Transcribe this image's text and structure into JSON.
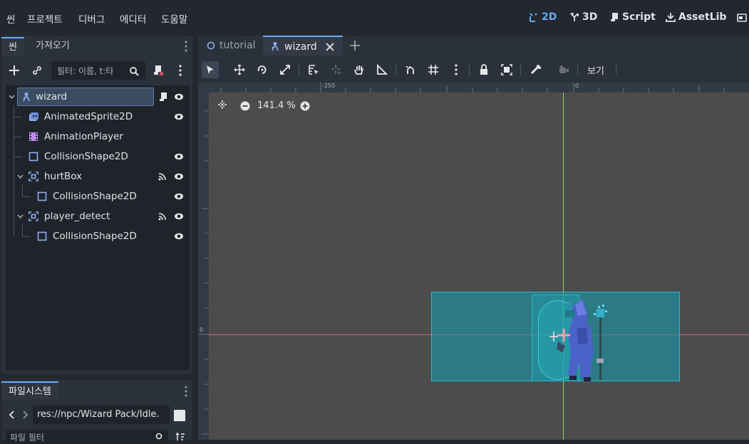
{
  "menubar": {
    "items": [
      "씬",
      "프로젝트",
      "디버그",
      "에디터",
      "도움말"
    ]
  },
  "main_screens": {
    "mode_2d": "2D",
    "mode_3d": "3D",
    "script": "Script",
    "assetlib": "AssetLib"
  },
  "scene_dock": {
    "tabs": [
      "씬",
      "가져오기"
    ],
    "filter_placeholder": "필터: 이름, t:타",
    "nodes": [
      {
        "name": "wizard",
        "selected": true,
        "has_script": true,
        "visible": true
      },
      {
        "name": "AnimatedSprite2D",
        "visible": true
      },
      {
        "name": "AnimationPlayer"
      },
      {
        "name": "CollisionShape2D",
        "visible": true
      },
      {
        "name": "hurtBox",
        "signals": true,
        "visible": true,
        "expanded": true
      },
      {
        "name": "CollisionShape2D",
        "visible": true
      },
      {
        "name": "player_detect",
        "signals": true,
        "visible": true,
        "expanded": true
      },
      {
        "name": "CollisionShape2D",
        "visible": true
      }
    ]
  },
  "filesystem_dock": {
    "tab": "파일시스템",
    "path": "res://npc/Wizard Pack/Idle.",
    "filter_placeholder": "파일 필터"
  },
  "editor": {
    "tabs": [
      "tutorial",
      "wizard"
    ],
    "active_tab": "wizard",
    "view_menu": "보기",
    "zoom": "141.4 %",
    "ruler_labels": [
      "-250",
      "0"
    ],
    "ruler_left_label": "0"
  },
  "colors": {
    "accent": "#64aef5",
    "viewport_bg": "#4c4c4c",
    "collision_fill": "#1a8c9c",
    "x_axis": "#d9607a",
    "y_axis": "#7ed957"
  }
}
